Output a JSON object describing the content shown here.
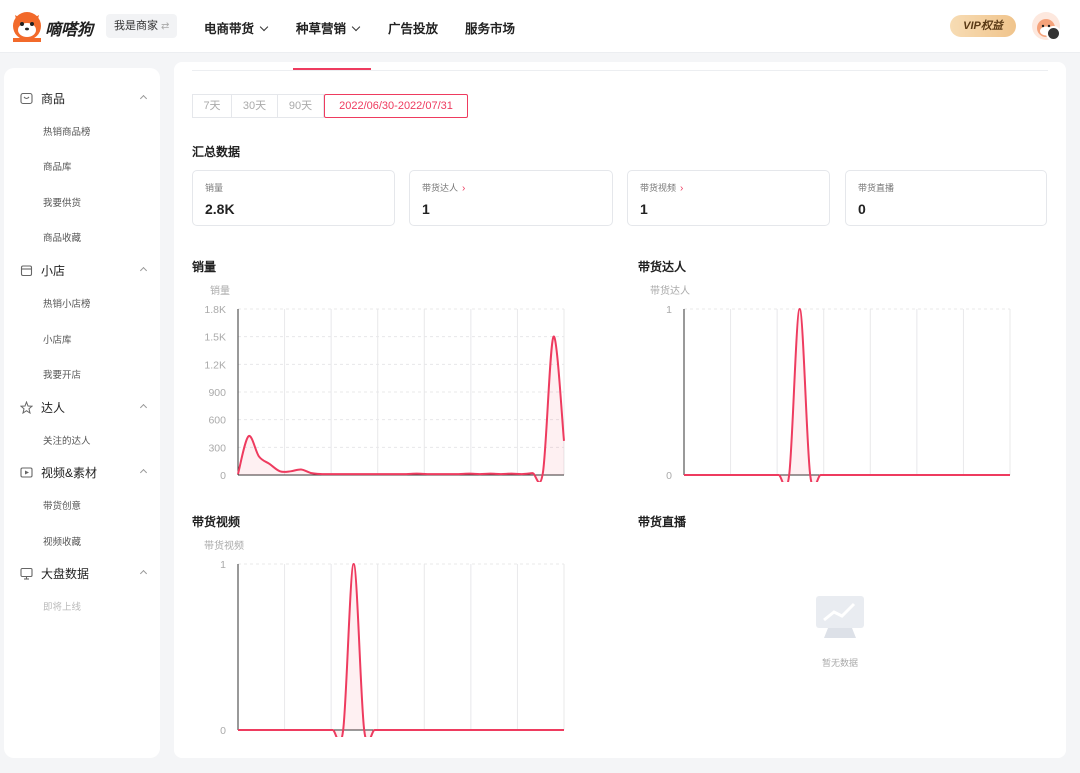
{
  "header": {
    "logo_text": "嘀嗒狗",
    "merchant_label": "我是商家",
    "nav": [
      "电商带货",
      "种草营销",
      "广告投放",
      "服务市场"
    ],
    "vip_label": "VIP权益"
  },
  "sidebar": {
    "sections": [
      {
        "label": "商品",
        "icon": "box-icon",
        "items": [
          "热销商品榜",
          "商品库",
          "我要供货",
          "商品收藏"
        ]
      },
      {
        "label": "小店",
        "icon": "shop-icon",
        "items": [
          "热销小店榜",
          "小店库",
          "我要开店"
        ]
      },
      {
        "label": "达人",
        "icon": "star-icon",
        "items": [
          "关注的达人"
        ]
      },
      {
        "label": "视频&素材",
        "icon": "video-icon",
        "items": [
          "带货创意",
          "视频收藏"
        ]
      },
      {
        "label": "大盘数据",
        "icon": "monitor-icon",
        "items": [
          "即将上线"
        ]
      }
    ]
  },
  "filters": {
    "ranges": [
      "7天",
      "30天",
      "90天"
    ],
    "custom_range": "2022/06/30-2022/07/31"
  },
  "summary": {
    "title": "汇总数据",
    "cards": [
      {
        "label": "销量",
        "value": "2.8K"
      },
      {
        "label": "带货达人",
        "value": "1"
      },
      {
        "label": "带货视频",
        "value": "1"
      },
      {
        "label": "带货直播",
        "value": "0"
      }
    ]
  },
  "chart_data": [
    {
      "type": "line",
      "title": "销量",
      "ylabel": "销量",
      "yticks": [
        "0",
        "300",
        "600",
        "900",
        "1.2K",
        "1.5K",
        "1.8K"
      ],
      "ylim": [
        0,
        1800
      ],
      "x": [
        0,
        1,
        2,
        3,
        4,
        5,
        6,
        7,
        8,
        9,
        10,
        11,
        12,
        13,
        14,
        15,
        16,
        17,
        18,
        19,
        20,
        21,
        22,
        23,
        24,
        25,
        26,
        27,
        28,
        29,
        30,
        31
      ],
      "values": [
        10,
        420,
        200,
        120,
        40,
        40,
        60,
        20,
        10,
        10,
        10,
        10,
        10,
        10,
        10,
        10,
        10,
        15,
        10,
        10,
        10,
        10,
        15,
        10,
        15,
        10,
        15,
        10,
        20,
        30,
        1500,
        370
      ],
      "color": "#ee3b5f"
    },
    {
      "type": "line",
      "title": "带货达人",
      "ylabel": "带货达人",
      "yticks": [
        "0",
        "1"
      ],
      "ylim": [
        0,
        1
      ],
      "x": [
        0,
        1,
        2,
        3,
        4,
        5,
        6,
        7,
        8,
        9,
        10,
        11,
        12,
        13,
        14,
        15,
        16,
        17,
        18,
        19,
        20,
        21,
        22,
        23,
        24,
        25,
        26,
        27,
        28,
        29,
        30,
        31
      ],
      "values": [
        0,
        0,
        0,
        0,
        0,
        0,
        0,
        0,
        0,
        0,
        0,
        1,
        0,
        0,
        0,
        0,
        0,
        0,
        0,
        0,
        0,
        0,
        0,
        0,
        0,
        0,
        0,
        0,
        0,
        0,
        0,
        0
      ],
      "color": "#ee3b5f"
    },
    {
      "type": "line",
      "title": "带货视频",
      "ylabel": "带货视频",
      "yticks": [
        "0",
        "1"
      ],
      "ylim": [
        0,
        1
      ],
      "x": [
        0,
        1,
        2,
        3,
        4,
        5,
        6,
        7,
        8,
        9,
        10,
        11,
        12,
        13,
        14,
        15,
        16,
        17,
        18,
        19,
        20,
        21,
        22,
        23,
        24,
        25,
        26,
        27,
        28,
        29,
        30,
        31
      ],
      "values": [
        0,
        0,
        0,
        0,
        0,
        0,
        0,
        0,
        0,
        0,
        0,
        1,
        0,
        0,
        0,
        0,
        0,
        0,
        0,
        0,
        0,
        0,
        0,
        0,
        0,
        0,
        0,
        0,
        0,
        0,
        0,
        0
      ],
      "color": "#ee3b5f"
    }
  ],
  "live_chart": {
    "title": "带货直播",
    "empty_text": "暂无数据"
  }
}
